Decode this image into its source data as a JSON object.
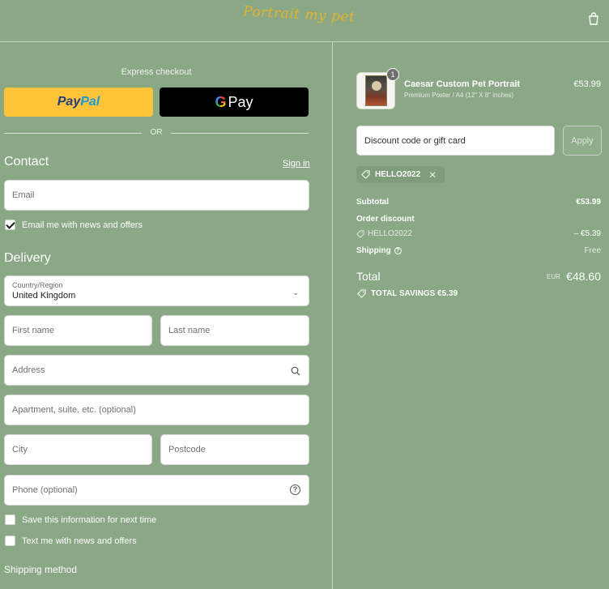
{
  "header": {
    "logo_text": "Portrait my pet",
    "cart_icon": "shopping-bag-icon"
  },
  "express": {
    "title": "Express checkout",
    "paypal_part1": "Pay",
    "paypal_part2": "Pal",
    "gpay_g": "G",
    "gpay_label": "Pay",
    "or_label": "OR"
  },
  "contact": {
    "title": "Contact",
    "sign_in": "Sign in",
    "email_placeholder": "Email",
    "news_checkbox": {
      "label": "Email me with news and offers",
      "checked": true
    }
  },
  "delivery": {
    "title": "Delivery",
    "country_label": "Country/Region",
    "country_value": "United Kingdom",
    "first_name": "First name",
    "last_name": "Last name",
    "address": "Address",
    "apartment": "Apartment, suite, etc. (optional)",
    "city": "City",
    "postcode": "Postcode",
    "phone": "Phone (optional)",
    "save_info": {
      "label": "Save this information for next time",
      "checked": false
    },
    "text_me": {
      "label": "Text me with news and offers",
      "checked": false
    },
    "shipping_method_title": "Shipping method"
  },
  "order": {
    "item": {
      "quantity": "1",
      "name": "Caesar Custom Pet Portrait",
      "variant": "Premium Poster / A4 (12\" X 8\" inches)",
      "price": "€53.99"
    },
    "discount_placeholder": "Discount code or gift card",
    "apply_label": "Apply",
    "applied_code": "HELLO2022",
    "subtotal_label": "Subtotal",
    "subtotal_value": "€53.99",
    "order_discount_label": "Order discount",
    "discount_code": "HELLO2022",
    "discount_value": "– €5.39",
    "shipping_label": "Shipping",
    "shipping_value": "Free",
    "total_label": "Total",
    "total_currency": "EUR",
    "total_value": "€48.60",
    "savings_label": "TOTAL SAVINGS  €5.39"
  },
  "colors": {
    "background": "#8aa886",
    "paypal": "#ffc439",
    "gpay": "#000000",
    "logo": "#e2b42c"
  }
}
